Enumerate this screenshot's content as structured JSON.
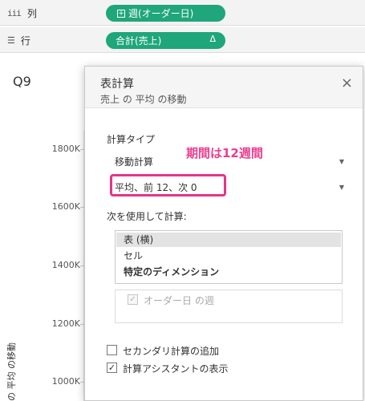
{
  "shelves": {
    "columns": {
      "icon": "iii",
      "label": "列",
      "pill": "週(オーダー日)"
    },
    "rows": {
      "icon": "☰",
      "label": "行",
      "pill": "合計(売上)",
      "pill_icon": "Δ"
    }
  },
  "chart": {
    "title": "Q9",
    "ticks": [
      "1800K",
      "1600K",
      "1400K",
      "1200K",
      "1000K"
    ],
    "ylabel": "の 平均 の移動"
  },
  "dialog": {
    "title": "表計算",
    "subtitle": "売上 の 平均 の移動",
    "close": "×",
    "calc_type_label": "計算タイプ",
    "calc_type_value": "移動計算",
    "params_value": "平均、前 12、次 0",
    "annotation": "期間は12週間",
    "compute_using_label": "次を使用して計算:",
    "compute_options": [
      "表 (横)",
      "セル",
      "特定のディメンション"
    ],
    "dimension_item": "オーダー日 の週",
    "secondary_calc": "セカンダリ計算の追加",
    "show_assistant": "計算アシスタントの表示"
  }
}
